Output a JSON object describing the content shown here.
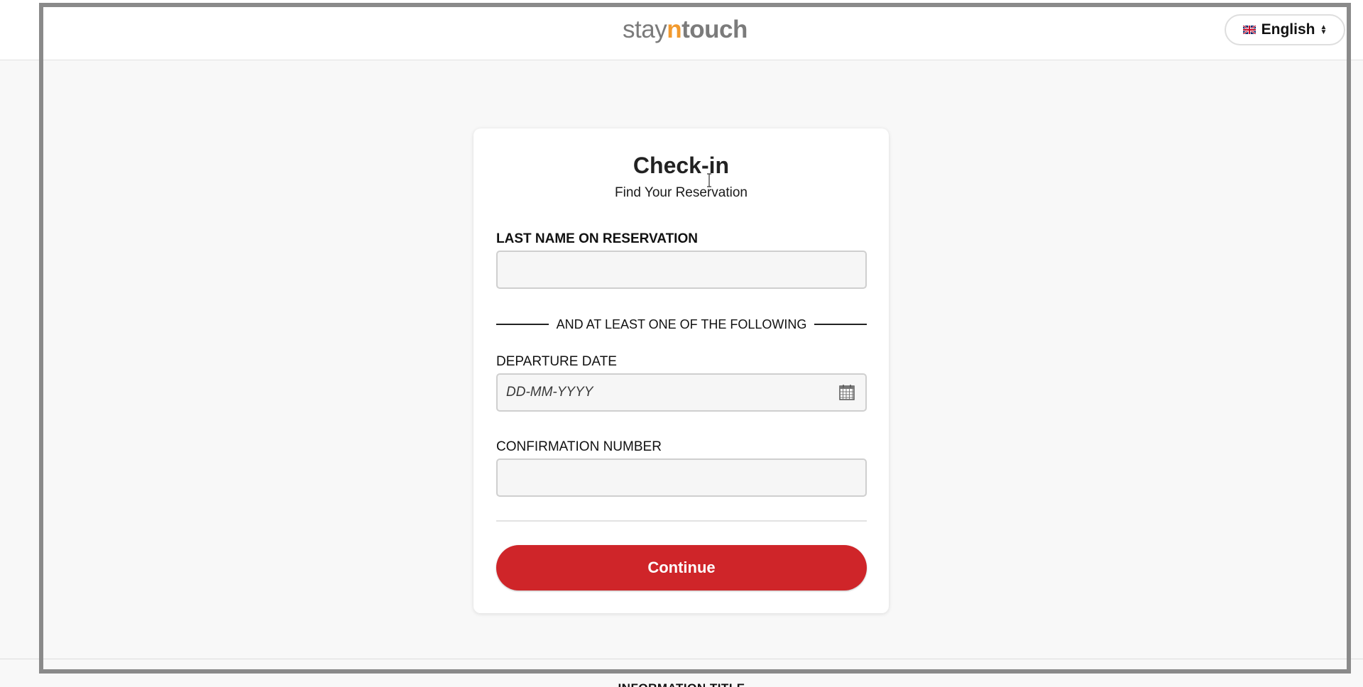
{
  "header": {
    "logo_part1": "stay",
    "logo_part2": "n",
    "logo_part3": "touch",
    "language": "English"
  },
  "card": {
    "title": "Check-in",
    "subtitle": "Find Your Reservation",
    "last_name_label": "LAST NAME ON RESERVATION",
    "last_name_value": "",
    "divider_text": "AND AT LEAST ONE OF THE FOLLOWING",
    "departure_label": "DEPARTURE DATE",
    "departure_placeholder": "DD-MM-YYYY",
    "confirmation_label": "CONFIRMATION NUMBER",
    "confirmation_value": "",
    "continue_label": "Continue"
  },
  "footer": {
    "title": "INFORMATION TITLE"
  },
  "icons": {
    "flag": "uk-flag-icon",
    "language_arrows": "up-down-arrows-icon",
    "calendar": "calendar-icon"
  },
  "colors": {
    "accent": "#cf2529",
    "logo_orange": "#f29a2e",
    "logo_gray": "#7b7b7b",
    "page_background": "#f8f8f8"
  }
}
